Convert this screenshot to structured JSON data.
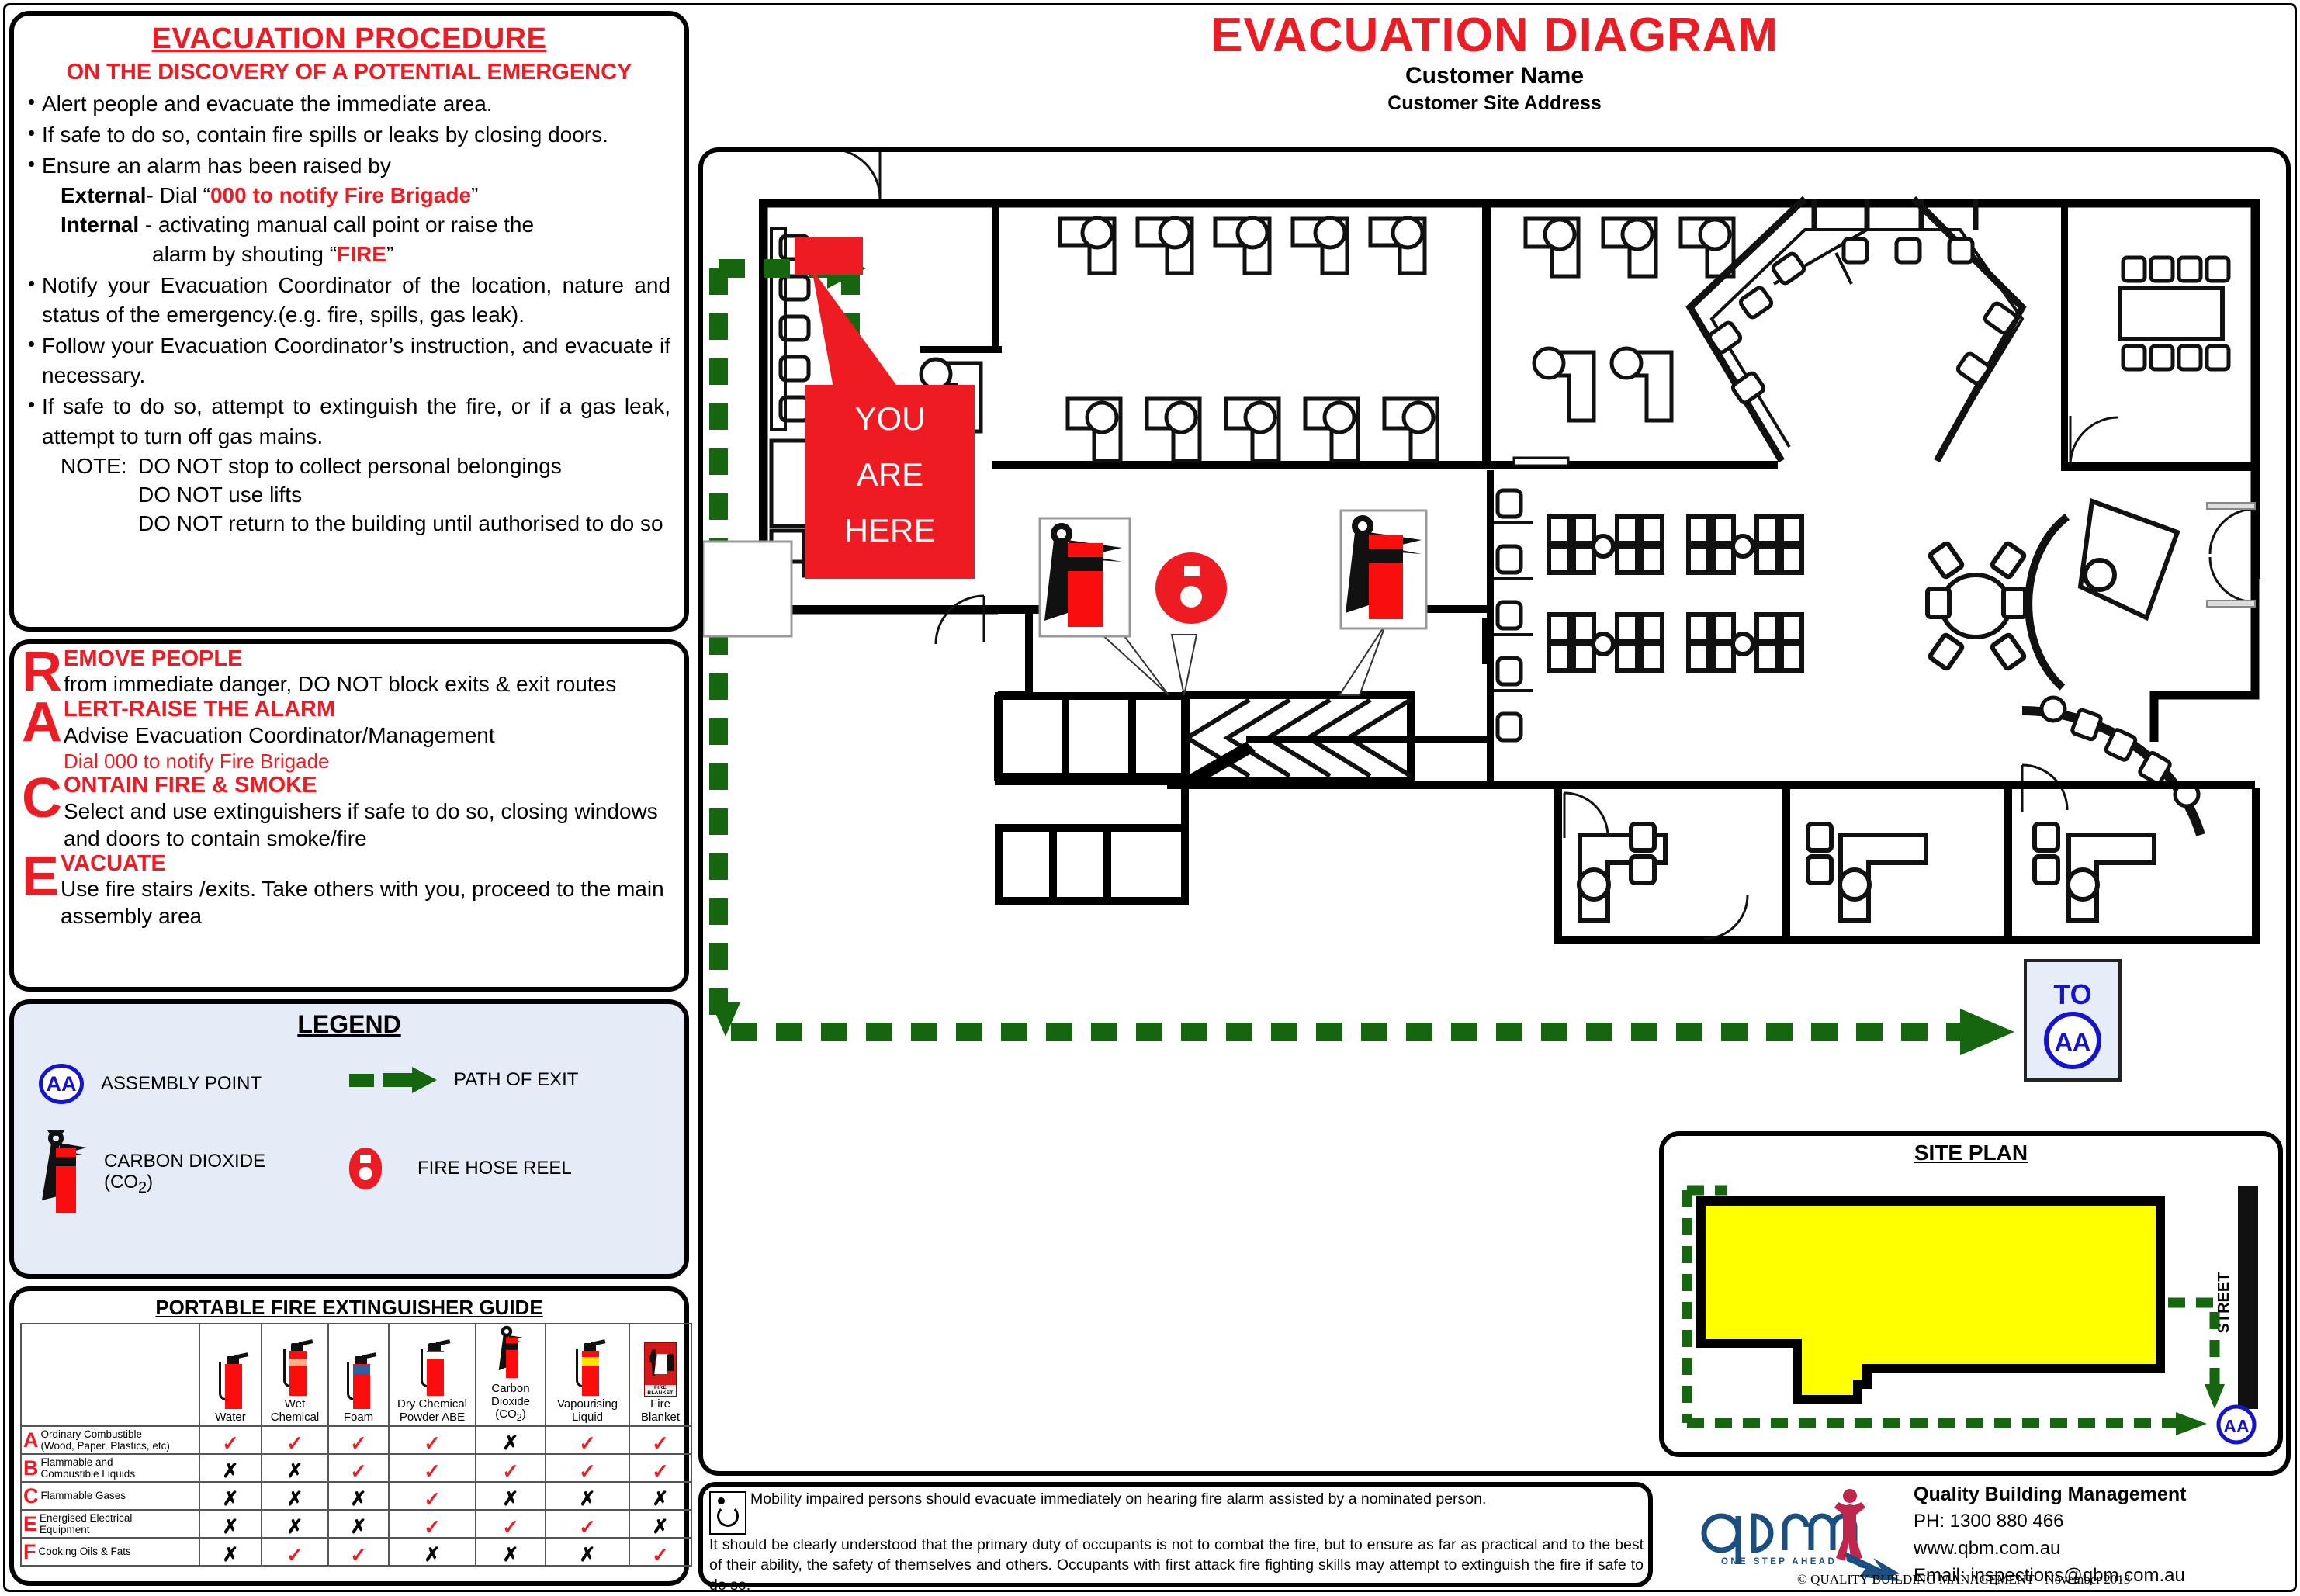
{
  "header": {
    "title": "EVACUATION  DIAGRAM",
    "customer_name": "Customer Name",
    "site_address": "Customer Site Address"
  },
  "procedure": {
    "title": "EVACUATION PROCEDURE",
    "subtitle": "ON THE DISCOVERY OF A POTENTIAL EMERGENCY",
    "bullets": [
      "Alert people and evacuate the immediate area.",
      "If safe to do so, contain fire spills or leaks by closing doors.",
      "Ensure an alarm has been raised by"
    ],
    "external_label": "External",
    "external_text": "- Dial “",
    "external_red": "000 to notify Fire Brigade",
    "external_close": "”",
    "internal_label": "Internal",
    "internal_text": " - activating manual call point or raise the",
    "internal_text2": "alarm by shouting “",
    "internal_red": "FIRE",
    "internal_close": "”",
    "bullets2": [
      "Notify your Evacuation Coordinator of the location, nature and status of the emergency.(e.g. fire, spills, gas leak).",
      "Follow your Evacuation Coordinator’s instruction, and evacuate if necessary.",
      "If safe to do so, attempt to extinguish the fire, or if a gas leak, attempt to turn off gas mains."
    ],
    "note_label": "NOTE:",
    "notes": [
      "DO NOT stop to collect personal belongings",
      "DO NOT use lifts",
      "DO NOT return to the building until authorised to do so"
    ]
  },
  "race": {
    "items": [
      {
        "letter": "R",
        "head": "EMOVE PEOPLE",
        "text": "from immediate danger, DO NOT block exits & exit routes",
        "red_text": ""
      },
      {
        "letter": "A",
        "head": "LERT-RAISE THE ALARM",
        "text": "Advise Evacuation Coordinator/Management",
        "red_text": "Dial 000 to notify Fire Brigade"
      },
      {
        "letter": "C",
        "head": "ONTAIN FIRE & SMOKE",
        "text": "Select and use extinguishers if safe to do so, closing windows and doors to contain smoke/fire",
        "red_text": ""
      },
      {
        "letter": "E",
        "head": "VACUATE",
        "text": "Use fire stairs /exits. Take others with you, proceed to the main assembly area",
        "red_text": ""
      }
    ]
  },
  "legend": {
    "title": "LEGEND",
    "items": [
      {
        "icon": "assembly-point-icon",
        "label": "ASSEMBLY POINT",
        "code": "AA"
      },
      {
        "icon": "path-of-exit-icon",
        "label": "PATH OF EXIT"
      },
      {
        "icon": "carbon-dioxide-extinguisher-icon",
        "label_line1": "CARBON DIOXIDE",
        "label_line2": "(CO2)"
      },
      {
        "icon": "fire-hose-reel-icon",
        "label": "FIRE HOSE REEL"
      }
    ]
  },
  "guide": {
    "title": "PORTABLE FIRE EXTINGUISHER GUIDE",
    "columns": [
      {
        "name": "Water",
        "line1": "",
        "line2": "Water",
        "icon": "water-extinguisher-icon",
        "band": "none"
      },
      {
        "name": "Wet Chemical",
        "line1": "Wet",
        "line2": "Chemical",
        "icon": "wet-chemical-extinguisher-icon",
        "band": "#f7b188"
      },
      {
        "name": "Foam",
        "line1": "",
        "line2": "Foam",
        "icon": "foam-extinguisher-icon",
        "band": "#2f5f9e"
      },
      {
        "name": "Dry Chemical Powder ABE",
        "line1": "Dry Chemical",
        "line2": "Powder ABE",
        "icon": "dry-chemical-extinguisher-icon",
        "band": "#ffffff"
      },
      {
        "name": "Carbon Dioxide (CO2)",
        "line1": "Carbon",
        "line15": "Dioxide",
        "line2": "(CO2)",
        "icon": "co2-extinguisher-icon",
        "band": "#111111"
      },
      {
        "name": "Vapourising Liquid",
        "line1": "Vapourising",
        "line2": "Liquid",
        "icon": "vapourising-liquid-extinguisher-icon",
        "band": "#ffe400"
      },
      {
        "name": "Fire Blanket",
        "line1": "Fire",
        "line2": "Blanket",
        "icon": "fire-blanket-icon",
        "band": "none"
      }
    ],
    "rows": [
      {
        "class": "A",
        "name_line1": "Ordinary Combustible",
        "name_line2": "(Wood, Paper, Plastics, etc)",
        "marks": [
          "tick",
          "tick",
          "tick",
          "tick",
          "cross",
          "tick",
          "tick"
        ]
      },
      {
        "class": "B",
        "name_line1": "Flammable and",
        "name_line2": "Combustible Liquids",
        "marks": [
          "cross",
          "cross",
          "tick",
          "tick",
          "tick",
          "tick",
          "tick"
        ]
      },
      {
        "class": "C",
        "name_line1": "Flammable Gases",
        "name_line2": "",
        "marks": [
          "cross",
          "cross",
          "cross",
          "tick",
          "cross",
          "cross",
          "cross"
        ]
      },
      {
        "class": "E",
        "name_line1": "Energised Electrical",
        "name_line2": "Equipment",
        "marks": [
          "cross",
          "cross",
          "cross",
          "tick",
          "tick",
          "tick",
          "cross"
        ]
      },
      {
        "class": "F",
        "name_line1": "Cooking Oils & Fats",
        "name_line2": "",
        "marks": [
          "cross",
          "tick",
          "tick",
          "cross",
          "cross",
          "cross",
          "tick"
        ]
      }
    ],
    "tick_symbol": "✓",
    "cross_symbol": "✗"
  },
  "plan": {
    "you_are_here": "YOU ARE HERE",
    "you_are_here_lines": [
      "YOU",
      "ARE",
      "HERE"
    ],
    "to_assembly_label": "TO",
    "to_assembly_code": "AA"
  },
  "site_plan": {
    "title": "SITE PLAN",
    "street_label": "STREET",
    "assembly_code": "AA"
  },
  "footer": {
    "mobility_note": "Mobility impaired persons should evacuate immediately on hearing fire alarm assisted by a nominated person.",
    "duty_note": "It should be clearly understood that the primary duty of occupants is not to combat the fire, but to ensure as far as practical and to the best  of their ability, the safety of themselves and others. Occupants with first attack fire fighting skills may attempt to extinguish the fire if safe to do so.",
    "company": "Quality Building Management",
    "phone": "PH: 1300 880 466",
    "website": "www.qbm.com.au",
    "email": "Email: inspections@qbm.com.au",
    "copyright": "© QUALITY BUILDING MANAGEMENT - November 2013",
    "logo_text": "qbm",
    "logo_tagline": "ONE STEP AHEAD"
  },
  "colors": {
    "red": "#ec1c24",
    "green": "#16660f",
    "blue": "#1414cd",
    "yellow": "#ffff00",
    "legend_bg": "#e6ecf7"
  }
}
